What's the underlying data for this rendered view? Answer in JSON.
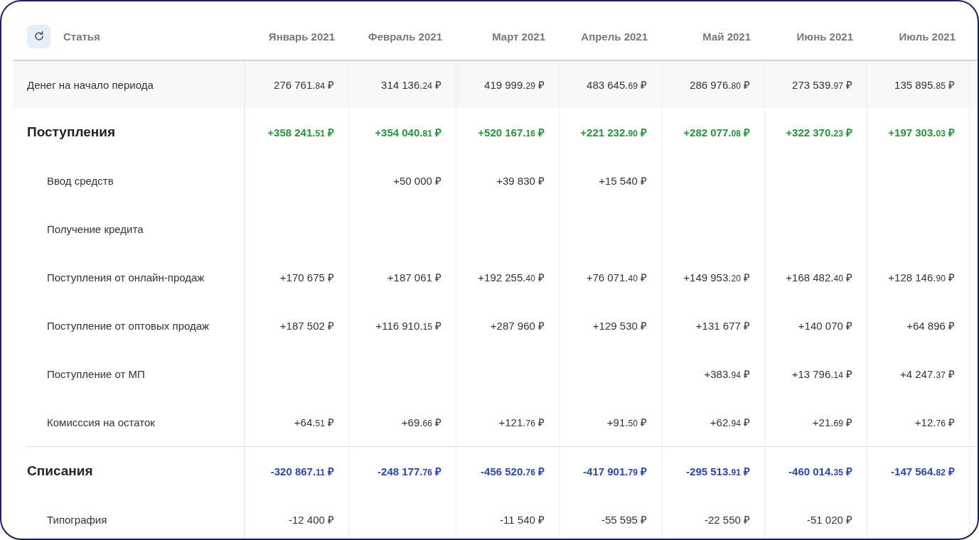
{
  "header": {
    "article_label": "Статья",
    "months": [
      "Январь 2021",
      "Февраль 2021",
      "Март 2021",
      "Апрель 2021",
      "Май 2021",
      "Июнь 2021",
      "Июль 2021"
    ]
  },
  "opening_balance": {
    "label": "Денег на начало периода",
    "values": {
      "1": "276 761.84 ₽",
      "2": "314 136.24 ₽",
      "3": "419 999.29 ₽",
      "4": "483 645.69 ₽",
      "5": "286 976.80 ₽",
      "6": "273 539.97 ₽",
      "7": "135 895.85 ₽"
    }
  },
  "groups": [
    {
      "label": "Поступления",
      "color": "#1f9a36",
      "values": {
        "1": "+358 241.51 ₽",
        "2": "+354 040.81 ₽",
        "3": "+520 167.16 ₽",
        "4": "+221 232.90 ₽",
        "5": "+282 077.08 ₽",
        "6": "+322 370.23 ₽",
        "7": "+197 303.03 ₽"
      },
      "children": [
        {
          "label": "Ввод средств",
          "values": {
            "2": "+50 000 ₽",
            "3": "+39 830 ₽",
            "4": "+15 540 ₽"
          }
        },
        {
          "label": "Получение кредита"
        },
        {
          "label": "Поступления от онлайн-продаж",
          "values": {
            "1": "+170 675 ₽",
            "2": "+187 061 ₽",
            "3": "+192 255.40 ₽",
            "4": "+76 071.40 ₽",
            "5": "+149 953.20 ₽",
            "6": "+168 482.40 ₽",
            "7": "+128 146.90 ₽"
          }
        },
        {
          "label": "Поступление от оптовых продаж",
          "values": {
            "1": "+187 502 ₽",
            "2": "+116 910.15 ₽",
            "3": "+287 960 ₽",
            "4": "+129 530 ₽",
            "5": "+131 677 ₽",
            "6": "+140 070 ₽",
            "7": "+64 896 ₽"
          }
        },
        {
          "label": "Поступление от МП",
          "values": {
            "5": "+383.94 ₽",
            "6": "+13 796.14 ₽",
            "7": "+4 247.37 ₽"
          }
        },
        {
          "label": "Комисссия на остаток",
          "values": {
            "1": "+64.51 ₽",
            "2": "+69.66 ₽",
            "3": "+121.76 ₽",
            "4": "+91.50 ₽",
            "5": "+62.94 ₽",
            "6": "+21.69 ₽",
            "7": "+12.76 ₽"
          }
        }
      ]
    },
    {
      "label": "Списания",
      "color": "#2747c0",
      "values": {
        "1": "-320 867.11 ₽",
        "2": "-248 177.76 ₽",
        "3": "-456 520.76 ₽",
        "4": "-417 901.79 ₽",
        "5": "-295 513.91 ₽",
        "6": "-460 014.35 ₽",
        "7": "-147 564.82 ₽"
      },
      "children": [
        {
          "label": "Типография",
          "values": {
            "1": "-12 400 ₽",
            "3": "-11 540 ₽",
            "4": "-55 595 ₽",
            "5": "-22 550 ₽",
            "6": "-51 020 ₽"
          }
        }
      ]
    }
  ]
}
